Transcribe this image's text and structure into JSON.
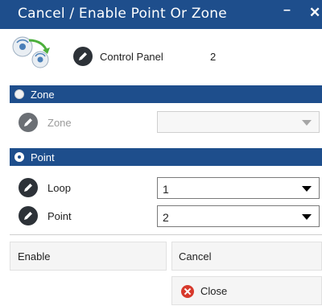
{
  "window": {
    "title": "Cancel / Enable Point Or Zone",
    "minimize_glyph": "–",
    "close_glyph": "✕"
  },
  "header": {
    "icon": "devices-transfer-icon",
    "control_panel_label": "Control Panel",
    "control_panel_value": "2"
  },
  "zone_section": {
    "label": "Zone",
    "selected": false,
    "field_label": "Zone",
    "field_value": "",
    "enabled": false
  },
  "point_section": {
    "label": "Point",
    "selected": true,
    "loop_label": "Loop",
    "loop_value": "1",
    "point_label": "Point",
    "point_value": "2"
  },
  "buttons": {
    "enable_label": "Enable",
    "cancel_label": "Cancel",
    "close_label": "Close"
  },
  "colors": {
    "accent": "#1e4e8c",
    "close_icon": "#d7392c"
  }
}
